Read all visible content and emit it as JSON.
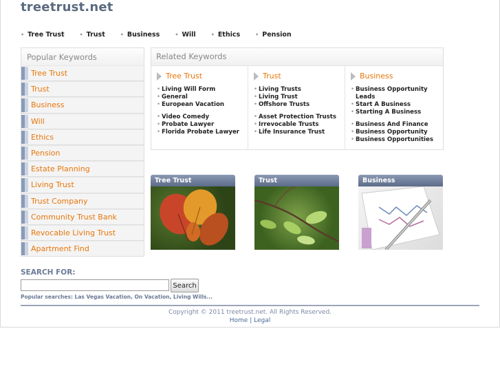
{
  "site": {
    "logo": "treetrust.net"
  },
  "topnav": [
    {
      "label": "Tree Trust"
    },
    {
      "label": "Trust"
    },
    {
      "label": "Business"
    },
    {
      "label": "Will"
    },
    {
      "label": "Ethics"
    },
    {
      "label": "Pension"
    }
  ],
  "popular": {
    "title": "Popular Keywords",
    "items": [
      "Tree Trust",
      "Trust",
      "Business",
      "Will",
      "Ethics",
      "Pension",
      "Estate Planning",
      "Living Trust",
      "Trust Company",
      "Community Trust Bank",
      "Revocable Living Trust",
      "Apartment Find"
    ]
  },
  "related": {
    "title": "Related Keywords",
    "columns": [
      {
        "title": "Tree Trust",
        "groups": [
          [
            "Living Will Form",
            "General",
            "European Vacation"
          ],
          [
            "Video Comedy",
            "Probate Lawyer",
            "Florida Probate Lawyer"
          ]
        ]
      },
      {
        "title": "Trust",
        "groups": [
          [
            "Living Trusts",
            "Living Trust",
            "Offshore Trusts"
          ],
          [
            "Asset Protection Trusts",
            "Irrevocable Trusts",
            "Life Insurance Trust"
          ]
        ]
      },
      {
        "title": "Business",
        "groups": [
          [
            "Business Opportunity Leads",
            "Start A Business",
            "Starting A Business"
          ],
          [
            "Business And Finance",
            "Business Opportunity",
            "Business Opportunities"
          ]
        ]
      }
    ]
  },
  "thumbs": [
    {
      "caption": "Tree Trust"
    },
    {
      "caption": "Trust"
    },
    {
      "caption": "Business"
    }
  ],
  "search": {
    "label": "SEARCH FOR:",
    "value": "",
    "button": "Search",
    "popular": "Popular searches: Las Vegas Vacation, On Vacation, Living Wills..."
  },
  "footer": {
    "copyright": "Copyright © 2011 treetrust.net. All Rights Reserved.",
    "home": "Home",
    "sep": "|",
    "legal": "Legal"
  }
}
